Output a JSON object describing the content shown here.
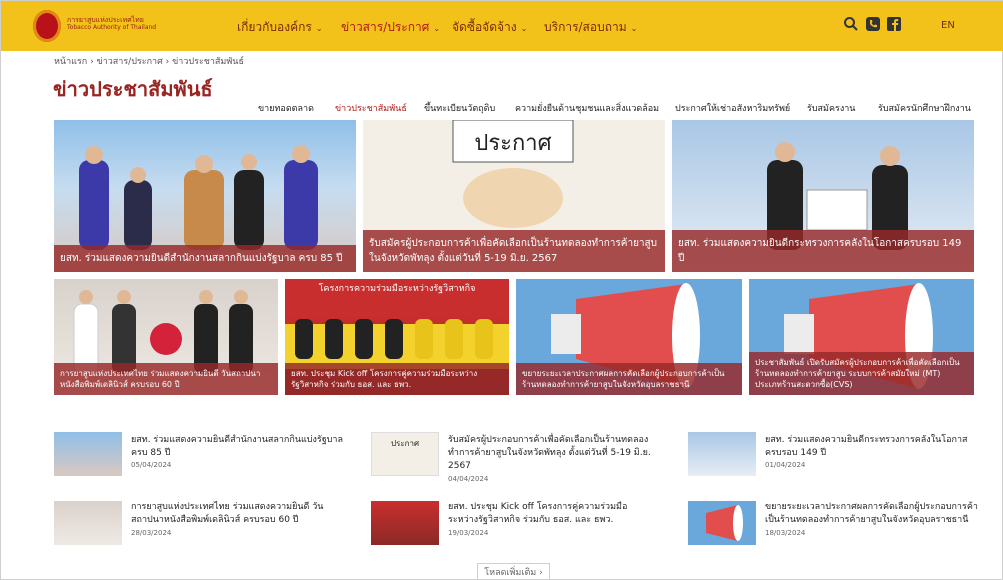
{
  "header": {
    "logo_text_th": "การยาสูบแห่งประเทศไทย",
    "logo_text_en": "Tobacco Authority of Thailand",
    "nav": [
      {
        "label": "เกี่ยวกับองค์กร"
      },
      {
        "label": "ข่าวสาร/ประกาศ"
      },
      {
        "label": "จัดซื้อจัดจ้าง"
      },
      {
        "label": "บริการ/สอบถาม"
      }
    ],
    "lang": "EN"
  },
  "breadcrumb": "หน้าแรก › ข่าวสาร/ประกาศ › ข่าวประชาสัมพันธ์",
  "page_title": "ข่าวประชาสัมพันธ์",
  "subnav": [
    "ขายทอดตลาด",
    "ข่าวประชาสัมพันธ์",
    "ขึ้นทะเบียนวัตถุดิบ",
    "ความยั่งยืนด้านชุมชนและสิ่งแวดล้อม",
    "ประกาศให้เช่าอสังหาริมทรัพย์",
    "รับสมัครงาน",
    "รับสมัครนักศึกษาฝึกงาน"
  ],
  "featured": [
    {
      "caption": "ยสท. ร่วมแสดงความยินดีสำนักงานสลากกินแบ่งรัฐบาล ครบ 85 ปี"
    },
    {
      "caption": "รับสมัครผู้ประกอบการค้าเพื่อคัดเลือกเป็นร้านทดลองทำการค้ายาสูบในจังหวัดพัทลุง ตั้งแต่วันที่ 5-19 มิ.ย. 2567",
      "sign_text": "ประกาศ"
    },
    {
      "caption": "ยสท. ร่วมแสดงความยินดีกระทรวงการคลังในโอกาสครบรอบ 149 ปี"
    }
  ],
  "small_tiles": [
    {
      "caption": "การยาสูบแห่งประเทศไทย ร่วมแสดงความยินดี วันสถาปนาหนังสือพิมพ์เดลินิวส์ ครบรอบ 60 ปี"
    },
    {
      "caption": "ยสท. ประชุม Kick off โครงการคู่ความร่วมมือระหว่างรัฐวิสาหกิจ ร่วมกับ ธอส. และ ธพว.",
      "banner_text": "โครงการความร่วมมือระหว่างรัฐวิสาหกิจ"
    },
    {
      "caption": "ขยายระยะเวลาประกาศผลการคัดเลือกผู้ประกอบการค้าเป็นร้านทดลองทำการค้ายาสูบในจังหวัดอุบลราชธานี"
    },
    {
      "caption": "ประชาสัมพันธ์ เปิดรับสมัครผู้ประกอบการค้าเพื่อคัดเลือกเป็นร้านทดลองทำการค้ายาสูบ ระบบการค้าสมัยใหม่ (MT) ประเภทร้านสะดวกซื้อ(CVS)"
    }
  ],
  "news": [
    {
      "title": "ยสท. ร่วมแสดงความยินดีสำนักงานสลากกินแบ่งรัฐบาล ครบ 85 ปี",
      "date": "05/04/2024"
    },
    {
      "title": "รับสมัครผู้ประกอบการค้าเพื่อคัดเลือกเป็นร้านทดลองทำการค้ายาสูบในจังหวัดพัทลุง ตั้งแต่วันที่ 5-19 มิ.ย. 2567",
      "date": "04/04/2024",
      "thumb_text": "ประกาศ"
    },
    {
      "title": "ยสท. ร่วมแสดงความยินดีกระทรวงการคลังในโอกาสครบรอบ 149 ปี",
      "date": "01/04/2024"
    },
    {
      "title": "การยาสูบแห่งประเทศไทย ร่วมแสดงความยินดี วันสถาปนาหนังสือพิมพ์เดลินิวส์ ครบรอบ 60 ปี",
      "date": "28/03/2024"
    },
    {
      "title": "ยสท. ประชุม Kick off โครงการคู่ความร่วมมือระหว่างรัฐวิสาหกิจ ร่วมกับ ธอส. และ ธพว.",
      "date": "19/03/2024"
    },
    {
      "title": "ขยายระยะเวลาประกาศผลการคัดเลือกผู้ประกอบการค้าเป็นร้านทดลองทำการค้ายาสูบในจังหวัดอุบลราชธานี",
      "date": "18/03/2024"
    }
  ],
  "load_more": "โหลดเพิ่มเติม ›",
  "colors": {
    "header_bg": "#f2c21b",
    "title": "#9a2421",
    "caption_bg": "#962828",
    "active": "#b01818"
  }
}
